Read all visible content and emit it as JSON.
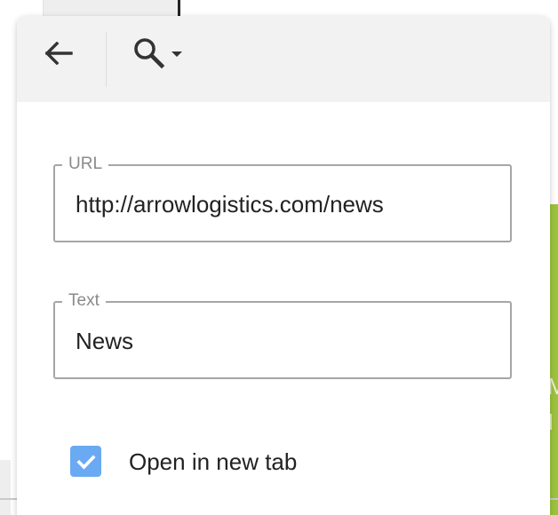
{
  "toolbar": {
    "back_icon": "arrow-left-icon",
    "search_icon": "search-icon",
    "dropdown_icon": "caret-down-icon"
  },
  "form": {
    "url": {
      "label": "URL",
      "value": "http://arrowlogistics.com/news"
    },
    "text": {
      "label": "Text",
      "value": "News"
    },
    "open_in_new_tab": {
      "label": "Open in new tab",
      "checked": true
    }
  },
  "colors": {
    "checkbox": "#6aaaf2",
    "toolbar_bg": "#f2f2f2",
    "field_border": "#a6a6a6",
    "background_accent": "#9cc33c"
  }
}
